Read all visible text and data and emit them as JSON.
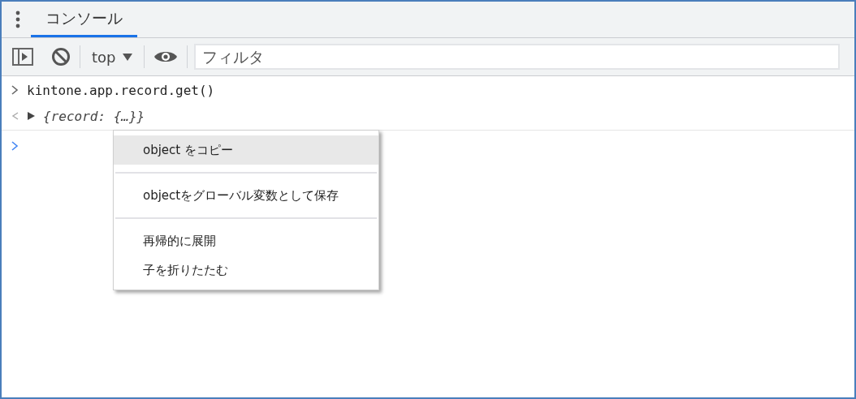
{
  "tabs": [
    {
      "label": "コンソール",
      "selected": true
    }
  ],
  "toolbar": {
    "context": "top",
    "filter": {
      "placeholder": "フィルタ"
    }
  },
  "console_lines": [
    {
      "kind": "input",
      "text": "kintone.app.record.get()"
    },
    {
      "kind": "result",
      "text": "{record: {…}}",
      "expanded": false
    },
    {
      "kind": "prompt"
    }
  ],
  "context_menu": {
    "items": [
      {
        "kind": "item",
        "label": "object をコピー",
        "selected": true
      },
      {
        "kind": "separator"
      },
      {
        "kind": "item",
        "label": "objectをグローバル変数として保存",
        "selected": false
      },
      {
        "kind": "separator"
      },
      {
        "kind": "item",
        "label": "再帰的に展開",
        "selected": false
      },
      {
        "kind": "item",
        "label": "子を折りたたむ",
        "selected": false
      }
    ]
  }
}
